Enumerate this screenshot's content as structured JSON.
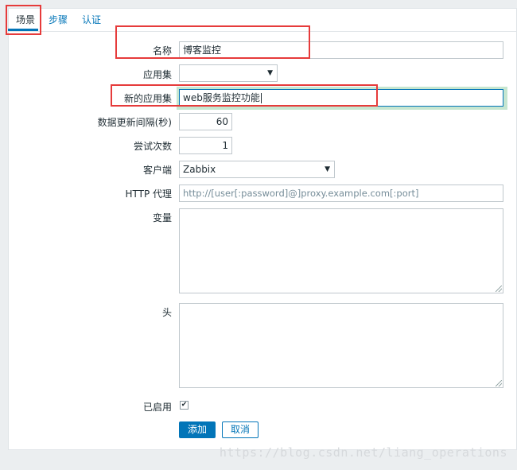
{
  "tabs": [
    {
      "label": "场景",
      "active": true
    },
    {
      "label": "步骤",
      "active": false
    },
    {
      "label": "认证",
      "active": false
    }
  ],
  "form": {
    "name": {
      "label": "名称",
      "value": "博客监控"
    },
    "app_set": {
      "label": "应用集",
      "value": ""
    },
    "new_app_set": {
      "label": "新的应用集",
      "value": "web服务监控功能"
    },
    "interval": {
      "label": "数据更新间隔(秒)",
      "value": "60"
    },
    "attempts": {
      "label": "尝试次数",
      "value": "1"
    },
    "client": {
      "label": "客户端",
      "value": "Zabbix"
    },
    "http_proxy": {
      "label": "HTTP 代理",
      "placeholder": "http://[user[:password]@]proxy.example.com[:port]"
    },
    "variables": {
      "label": "变量",
      "value": ""
    },
    "headers": {
      "label": "头",
      "value": ""
    },
    "enabled": {
      "label": "已启用",
      "checked": true
    }
  },
  "buttons": {
    "add": "添加",
    "cancel": "取消"
  },
  "watermark": "https://blog.csdn.net/liang_operations",
  "colors": {
    "accent": "#0275b8",
    "highlight": "#e63b3b"
  }
}
